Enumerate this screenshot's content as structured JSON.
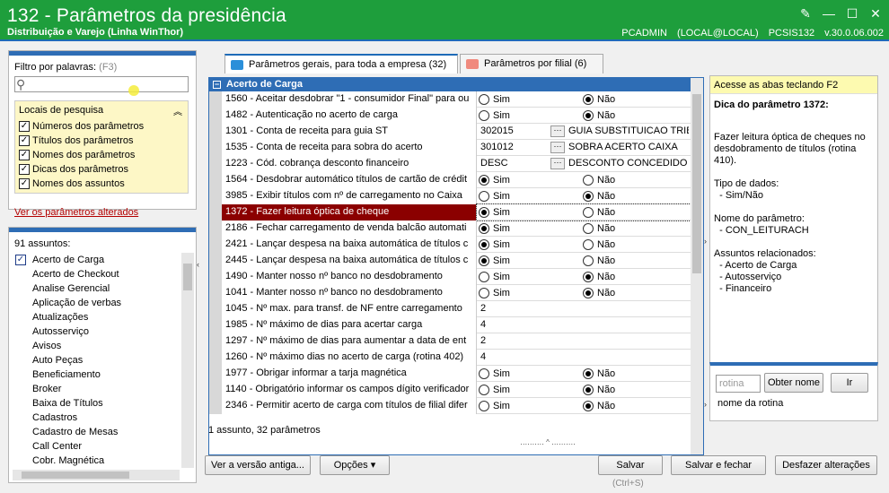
{
  "window": {
    "title": "132 - Parâmetros da presidência",
    "subtitle": "Distribuição e Varejo (Linha WinThor)",
    "info": "PCADMIN (LOCAL@LOCAL)   PCSIS132   v.30.0.06.002"
  },
  "filter": {
    "label": "Filtro por palavras:",
    "shortcut": "(F3)",
    "value": ""
  },
  "locais": {
    "title": "Locais de pesquisa",
    "items": [
      "Números dos parâmetros",
      "Títulos dos parâmetros",
      "Nomes dos parâmetros",
      "Dicas dos parâmetros",
      "Nomes dos assuntos"
    ]
  },
  "altered_link": "Ver os parâmetros alterados",
  "assuntos": {
    "count_label": "91 assuntos:",
    "items": [
      "Acerto de Carga",
      "Acerto de Checkout",
      "Analise Gerencial",
      "Aplicação de verbas",
      "Atualizações",
      "Autosserviço",
      "Avisos",
      "Auto Peças",
      "Beneficiamento",
      "Broker",
      "Baixa de Títulos",
      "Cadastros",
      "Cadastro de Mesas",
      "Call Center",
      "Cobr. Magnética"
    ]
  },
  "tabs": [
    {
      "label": "Parâmetros gerais, para toda a empresa",
      "count": "(32)"
    },
    {
      "label": "Parâmetros por filial",
      "count": "(6)"
    }
  ],
  "group": "Acerto de Carga",
  "yes": "Sim",
  "no": "Não",
  "params": [
    {
      "name": "1560 - Aceitar desdobrar \"1 - consumidor Final\" para ou",
      "type": "radio",
      "value": "no"
    },
    {
      "name": "1482 - Autenticação no acerto de carga",
      "type": "radio",
      "value": "no"
    },
    {
      "name": "1301 - Conta de receita para guia ST",
      "type": "lookup",
      "code": "302015",
      "desc": "GUIA SUBSTITUICAO TRIBU"
    },
    {
      "name": "1535 - Conta de receita para sobra do acerto",
      "type": "lookup",
      "code": "301012",
      "desc": "SOBRA ACERTO CAIXA"
    },
    {
      "name": "1223 - Cód. cobrança desconto financeiro",
      "type": "lookup",
      "code": "DESC",
      "desc": "DESCONTO CONCEDIDO"
    },
    {
      "name": "1564 - Desdobrar automático títulos de cartão de crédit",
      "type": "radio",
      "value": "yes"
    },
    {
      "name": "3985 - Exibir títulos com nº de carregamento no Caixa",
      "type": "radio",
      "value": "no"
    },
    {
      "name": "1372 - Fazer leitura óptica de cheque",
      "type": "radio",
      "value": "yes",
      "highlight": true
    },
    {
      "name": "2186 - Fechar carregamento de venda balcão automati",
      "type": "radio",
      "value": "yes"
    },
    {
      "name": "2421 - Lançar despesa na baixa automática de títulos c",
      "type": "radio",
      "value": "yes"
    },
    {
      "name": "2445 - Lançar despesa na baixa automática de títulos c",
      "type": "radio",
      "value": "yes"
    },
    {
      "name": "1490 - Manter nosso nº banco no desdobramento",
      "type": "radio",
      "value": "no"
    },
    {
      "name": "1041 - Manter nosso nº banco no desdobramento",
      "type": "radio",
      "value": "no"
    },
    {
      "name": "1045 - Nº max. para transf. de NF entre carregamento",
      "type": "text",
      "code": "2"
    },
    {
      "name": "1985 - Nº máximo de dias para acertar carga",
      "type": "text",
      "code": "4"
    },
    {
      "name": "1297 - Nº máximo de dias para aumentar a data de ent",
      "type": "text",
      "code": "2"
    },
    {
      "name": "1260 - Nº máximo dias no acerto de carga (rotina 402)",
      "type": "text",
      "code": "4"
    },
    {
      "name": "1977 - Obrigar informar a tarja magnética",
      "type": "radio",
      "value": "no"
    },
    {
      "name": "1140 - Obrigatório informar os campos dígito verificador",
      "type": "radio",
      "value": "no"
    },
    {
      "name": "2346 - Permitir acerto de carga com títulos de filial difer",
      "type": "radio",
      "value": "no"
    }
  ],
  "status": "1 assunto, 32 parâmetros",
  "help": {
    "hint": "Acesse as abas teclando F2",
    "title": "Dica do parâmetro 1372:",
    "body": "Fazer leitura óptica de cheques no desdobramento de títulos (rotina 410).\n\nTipo de dados:\n  - Sim/Não\n\nNome do parâmetro:\n  - CON_LEITURACH\n\nAssuntos relacionados:\n  - Acerto de Carga\n  - Autosserviço\n  - Financeiro"
  },
  "rotina": {
    "placeholder": "rotina",
    "get_label": "Obter nome",
    "go_label": "Ir",
    "name_label": "nome da rotina"
  },
  "buttons": {
    "old_version": "Ver a versão antiga...",
    "options": "Opções ▾",
    "save": "Salvar",
    "save_shortcut": "(Ctrl+S)",
    "save_close": "Salvar e fechar",
    "undo": "Desfazer alterações"
  },
  "colors": {
    "titlebar": "#1e9e3c",
    "accent": "#2e6db5",
    "highlight": "#8b0000",
    "hint": "#fdfab0"
  }
}
